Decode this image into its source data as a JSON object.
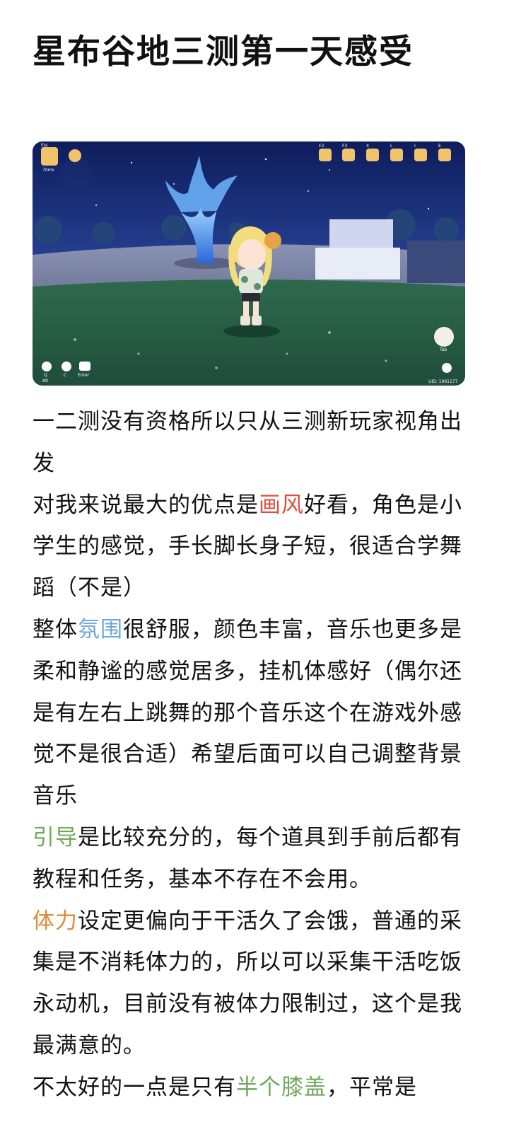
{
  "post": {
    "title": "星布谷地三测第一天感受"
  },
  "game_hud": {
    "esc": "Esc",
    "ping": "70ms",
    "f2": "F2",
    "f3": "F3",
    "x": "X",
    "l": "L",
    "i": "I",
    "e": "E",
    "tab": "Tab",
    "q": "Q",
    "c": "C",
    "enter": "Enter",
    "alt": "Alt",
    "uid": "UID: 1961177"
  },
  "paragraphs": [
    {
      "p1": "一二测没有资格所以只从三测新玩家视角出发"
    },
    {
      "pre": "对我来说最大的优点是",
      "hl": "画风",
      "post": "好看，角色是小学生的感觉，手长脚长身子短，很适合学舞蹈（不是）"
    },
    {
      "pre": "整体",
      "hl": "氛围",
      "post": "很舒服，颜色丰富，音乐也更多是柔和静谧的感觉居多，挂机体感好（偶尔还是有左右上跳舞的那个音乐这个在游戏外感觉不是很合适）希望后面可以自己调整背景音乐"
    },
    {
      "hl": "引导",
      "post": "是比较充分的，每个道具到手前后都有教程和任务，基本不存在不会用。"
    },
    {
      "hl": "体力",
      "post": "设定更偏向于干活久了会饿，普通的采集是不消耗体力的，所以可以采集干活吃饭永动机，目前没有被体力限制过，这个是我最满意的。"
    },
    {
      "pre": "不太好的一点是只有",
      "hl": "半个膝盖",
      "post": "，平常是"
    }
  ],
  "colors": {
    "highlight_red": "#d9503b",
    "highlight_blue": "#6aa6dc",
    "highlight_green": "#6fa85a",
    "highlight_orange": "#e08a3a"
  }
}
